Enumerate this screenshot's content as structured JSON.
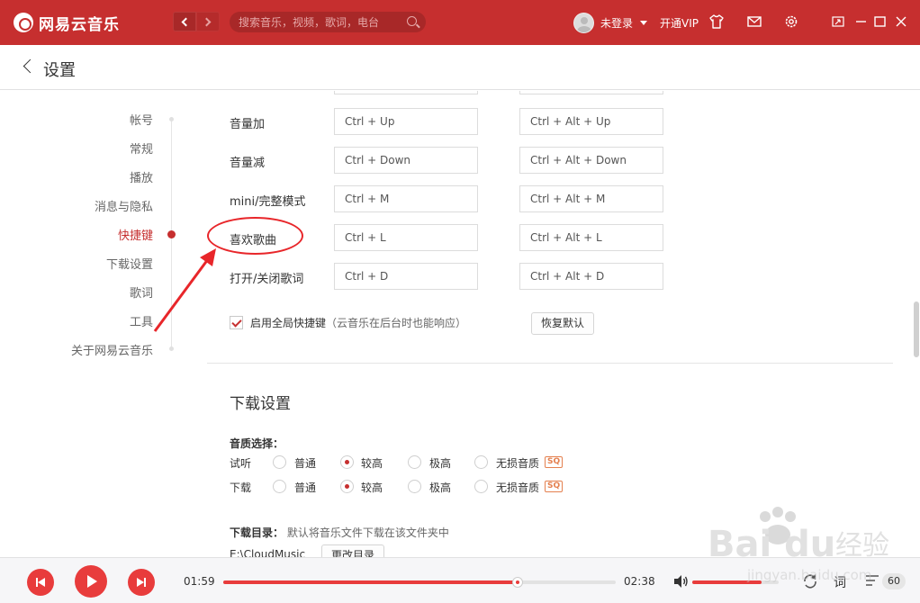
{
  "app": {
    "name": "网易云音乐",
    "search_placeholder": "搜索音乐，视频，歌词，电台",
    "user_name": "未登录",
    "vip_label": "开通VIP"
  },
  "page": {
    "title": "设置"
  },
  "sidebar": {
    "items": [
      {
        "label": "帐号",
        "active": false
      },
      {
        "label": "常规",
        "active": false
      },
      {
        "label": "播放",
        "active": false
      },
      {
        "label": "消息与隐私",
        "active": false
      },
      {
        "label": "快捷键",
        "active": true
      },
      {
        "label": "下载设置",
        "active": false
      },
      {
        "label": "歌词",
        "active": false
      },
      {
        "label": "工具",
        "active": false
      },
      {
        "label": "关于网易云音乐",
        "active": false
      }
    ]
  },
  "shortcuts": {
    "rows": [
      {
        "label": "音量加",
        "local": "Ctrl + Up",
        "global": "Ctrl + Alt + Up"
      },
      {
        "label": "音量减",
        "local": "Ctrl + Down",
        "global": "Ctrl + Alt + Down"
      },
      {
        "label": "mini/完整模式",
        "local": "Ctrl + M",
        "global": "Ctrl + Alt + M"
      },
      {
        "label": "喜欢歌曲",
        "local": "Ctrl + L",
        "global": "Ctrl + Alt + L"
      },
      {
        "label": "打开/关闭歌词",
        "local": "Ctrl + D",
        "global": "Ctrl + Alt + D"
      }
    ],
    "global_checkbox_label": "启用全局快捷键",
    "global_checkbox_note": "（云音乐在后台时也能响应）",
    "global_checked": true,
    "restore_label": "恢复默认"
  },
  "download": {
    "section_title": "下载设置",
    "quality_title": "音质选择：",
    "quality_rows": [
      {
        "label": "试听",
        "selected": 1
      },
      {
        "label": "下载",
        "selected": 1
      }
    ],
    "quality_options": [
      "普通",
      "较高",
      "极高",
      "无损音质"
    ],
    "sq_badge": "SQ",
    "dir_title": "下载目录：",
    "dir_note": "默认将音乐文件下载在该文件夹中",
    "dir_path": "E:\\CloudMusic",
    "change_dir_label": "更改目录"
  },
  "player": {
    "time_current": "01:59",
    "time_total": "02:38",
    "progress_fraction": 0.75,
    "volume_fraction": 0.8,
    "lyric_label": "词",
    "playlist_count": "60"
  },
  "annotation": {
    "color": "#e8262a"
  },
  "watermark": {
    "text": "Baidu经验",
    "sub": "jingyan.baidu.com"
  },
  "colors": {
    "brand": "#c62f2f",
    "accent": "#e83c3c"
  }
}
